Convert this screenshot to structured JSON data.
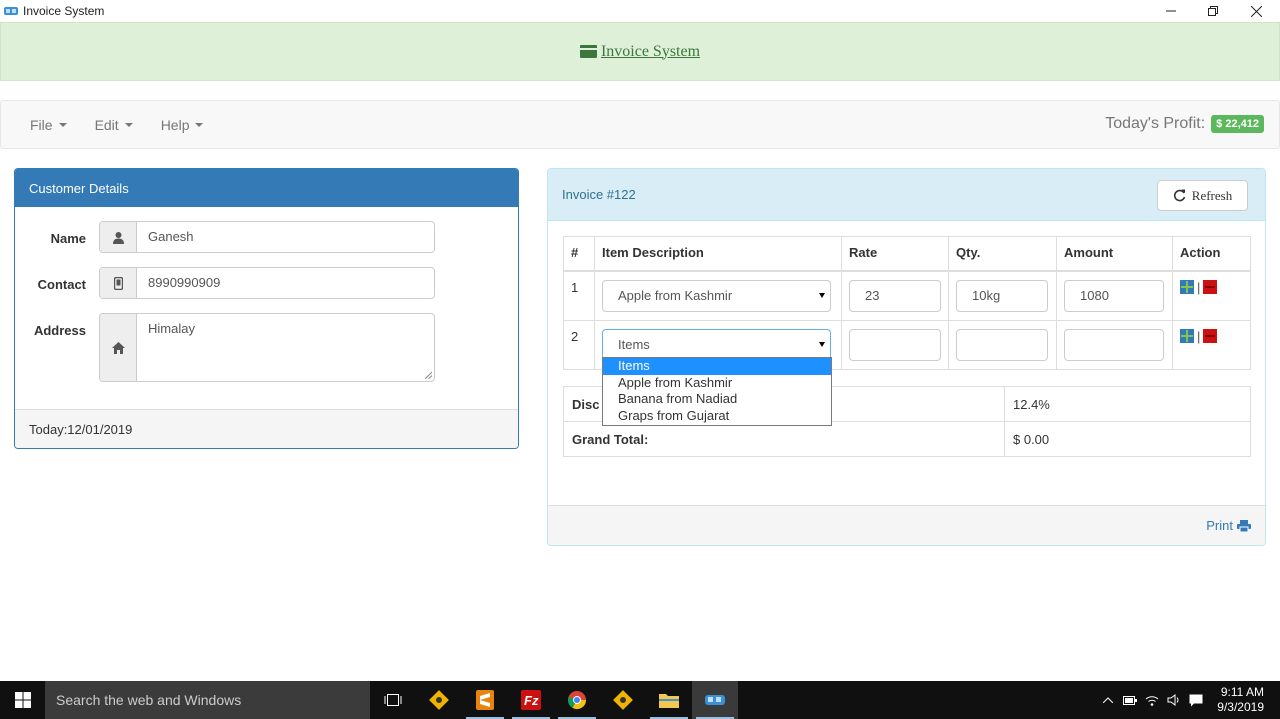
{
  "window": {
    "title": "Invoice System"
  },
  "header": {
    "brand": "Invoice System"
  },
  "menubar": {
    "items": [
      {
        "label": "File"
      },
      {
        "label": "Edit"
      },
      {
        "label": "Help"
      }
    ],
    "profit_label": "Today's Profit:",
    "profit_value": "$ 22,412"
  },
  "customer": {
    "panel_title": "Customer Details",
    "name_label": "Name",
    "name_value": "Ganesh",
    "contact_label": "Contact",
    "contact_value": "8990990909",
    "address_label": "Address",
    "address_value": "Himalay",
    "footer": "Today:12/01/2019"
  },
  "invoice": {
    "title": "Invoice #122",
    "refresh_label": "Refresh",
    "columns": [
      "#",
      "Item Description",
      "Rate",
      "Qty.",
      "Amount",
      "Action"
    ],
    "rows": [
      {
        "num": "1",
        "item": "Apple from Kashmir",
        "rate": "23",
        "qty": "10kg",
        "amount": "1080"
      },
      {
        "num": "2",
        "item": "Items",
        "rate": "",
        "qty": "",
        "amount": ""
      }
    ],
    "action_separator": "|",
    "discount_label": "Disc",
    "discount_value": "12.4%",
    "grand_total_label": "Grand Total:",
    "grand_total_value": "$ 0.00",
    "print_label": "Print",
    "dropdown_options": [
      "Items",
      "Apple from Kashmir",
      "Banana from Nadiad",
      "Graps from Gujarat"
    ]
  },
  "taskbar": {
    "search_placeholder": "Search the web and Windows",
    "time": "9:11 AM",
    "date": "9/3/2019"
  },
  "colors": {
    "primary": "#337ab7",
    "success": "#5cb85c",
    "header_bg": "#dff0d8",
    "info_bg": "#d9edf7"
  }
}
